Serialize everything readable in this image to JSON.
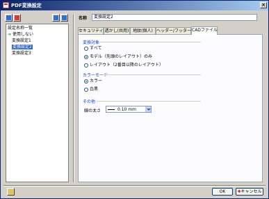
{
  "window": {
    "title": "PDF変換設定"
  },
  "left": {
    "list_heading": "設定名称一覧",
    "items": [
      {
        "label": "使用しない",
        "selected": false,
        "arrow": true
      },
      {
        "label": "変換設定1",
        "selected": false,
        "arrow": false
      },
      {
        "label": "変換設定2",
        "selected": true,
        "arrow": false
      },
      {
        "label": "変換設定3",
        "selected": false,
        "arrow": false
      }
    ]
  },
  "main": {
    "name_label": "名称",
    "name_value": "変換設定2",
    "tabs": [
      {
        "label": "セキュリティ",
        "active": false
      },
      {
        "label": "透かし(共用)",
        "active": false
      },
      {
        "label": "地紋(個人)",
        "active": false
      },
      {
        "label": "ヘッダー/フッター",
        "active": false
      },
      {
        "label": "CADファイル",
        "active": true
      }
    ],
    "groups": {
      "target": {
        "title": "変換対象",
        "options": [
          {
            "label": "すべて",
            "checked": false
          },
          {
            "label": "モデル（先頭のレイアウト）のみ",
            "checked": true
          },
          {
            "label": "レイアウト（2番目以降のレイアウト）",
            "checked": false
          }
        ]
      },
      "color_mode": {
        "title": "カラーモード",
        "options": [
          {
            "label": "カラー",
            "checked": true
          },
          {
            "label": "白黒",
            "checked": false
          }
        ]
      },
      "other": {
        "title": "その他",
        "line_width_label": "線の太さ",
        "line_width_value": "0.10 mm"
      }
    }
  },
  "footer": {
    "ok_label": "OK",
    "cancel_label": "キャンセル"
  },
  "colors": {
    "accent": "#0046d5",
    "selection": "#316ac5",
    "titlebar": "#0a246a"
  }
}
